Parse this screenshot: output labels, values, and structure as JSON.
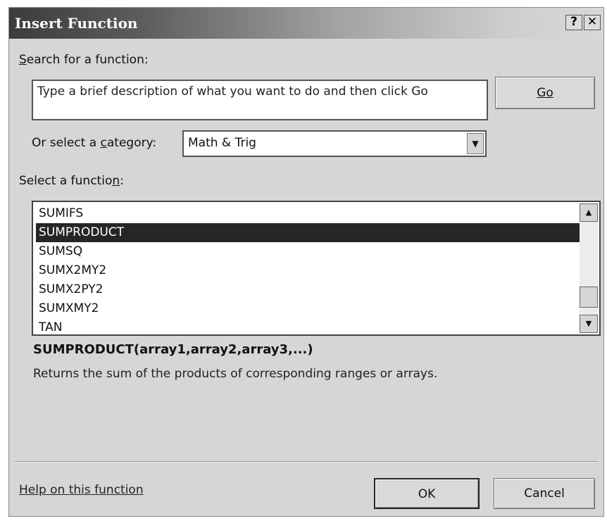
{
  "window": {
    "title": "Insert Function",
    "help_glyph": "?",
    "close_glyph": "✕"
  },
  "search": {
    "label": "Search for a function:",
    "value": "Type a brief description of what you want to do and then click Go",
    "go_label": "Go"
  },
  "category": {
    "label": "Or select a category:",
    "selected": "Math & Trig"
  },
  "functions": {
    "label": "Select a function:",
    "items": [
      "SUMIFS",
      "SUMPRODUCT",
      "SUMSQ",
      "SUMX2MY2",
      "SUMX2PY2",
      "SUMXMY2",
      "TAN"
    ],
    "selected": "SUMPRODUCT"
  },
  "details": {
    "signature": "SUMPRODUCT(array1,array2,array3,...)",
    "description": "Returns the sum of the products of corresponding ranges or arrays."
  },
  "footer": {
    "help_link": "Help on this function",
    "ok_label": "OK",
    "cancel_label": "Cancel"
  },
  "icons": {
    "dropdown": "chevron-down-icon",
    "scroll_up": "arrow-up-icon",
    "scroll_down": "arrow-down-icon",
    "help": "help-icon",
    "close": "close-icon"
  }
}
